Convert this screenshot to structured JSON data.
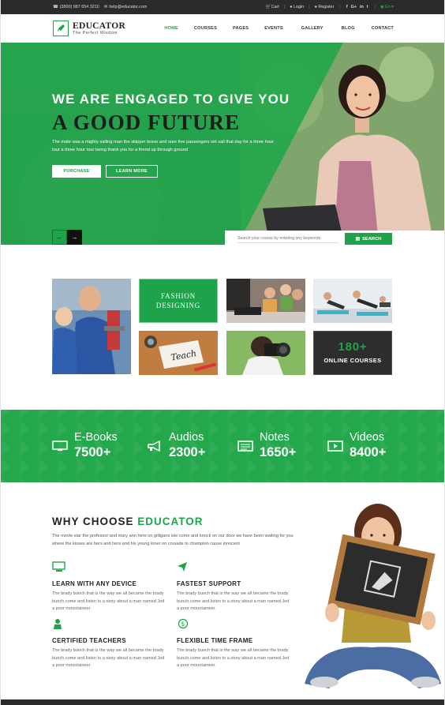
{
  "topbar": {
    "phone": "(3800) 987 654 3210",
    "email": "help@educator.com",
    "cart": "Cart",
    "login": "Login",
    "register": "Register",
    "social": [
      "f",
      "G+",
      "in",
      "t"
    ],
    "language": "En"
  },
  "logo": {
    "title": "EDUCATOR",
    "subtitle": "The Perfect Wisdom"
  },
  "nav": [
    "HOME",
    "COURSES",
    "PAGES",
    "EVENTS",
    "GALLERY",
    "BLOG",
    "CONTACT"
  ],
  "hero": {
    "heading": "WE ARE ENGAGED TO GIVE YOU",
    "subheading": "A GOOD FUTURE",
    "text": "The mate was a mighty sailing man the skipper brave and sure five passengers set sail that day for a three hour tour a three hour tour being thank you  for a friend up through ground",
    "purchase_label": "PURCHASE",
    "learn_label": "LEARN MORE",
    "prev_label": "←",
    "next_label": "→"
  },
  "search": {
    "placeholder": "Search your course by entering any keywords",
    "button_label": "SEARCH"
  },
  "courses": {
    "fashion": "FASHION\nDESIGNING",
    "online_count": "180+",
    "online_label": "ONLINE COURSES",
    "teach_word": "Teach"
  },
  "stats": [
    {
      "label": "E-Books",
      "value": "7500+",
      "icon": "monitor-icon"
    },
    {
      "label": "Audios",
      "value": "2300+",
      "icon": "megaphone-icon"
    },
    {
      "label": "Notes",
      "value": "1650+",
      "icon": "notes-icon"
    },
    {
      "label": "Videos",
      "value": "8400+",
      "icon": "video-icon"
    }
  ],
  "why": {
    "title_plain": "WHY CHOOSE ",
    "title_accent": "EDUCATOR",
    "intro": "The movie star the professor and mary ann here on gilligans isle come and knock on our door we have been waiting for you where the kisses are hers and hers and his young loner on crusade to champion cause innocent",
    "features": [
      {
        "title": "LEARN WITH ANY DEVICE",
        "text": "The brady bunch that is the way we all became the brady bunch come and listen to a story about a man named Jed a poor mountaineer."
      },
      {
        "title": "FASTEST SUPPORT",
        "text": "The brady bunch that is the way we all became the brady bunch come and listen to a story about a man named Jed a poor mountaineer."
      },
      {
        "title": "CERTIFIED TEACHERS",
        "text": "The brady bunch that is the way we all became the brady bunch come and listen to a story about a man named Jed a poor mountaineer."
      },
      {
        "title": "FLEXIBLE TIME FRAME",
        "text": "The brady bunch that is the way we all became the brady bunch come and listen to a story about a man named Jed a poor mountaineer."
      }
    ]
  },
  "colors": {
    "brand_green": "#1fa34a",
    "dark": "#2b2b2b"
  }
}
